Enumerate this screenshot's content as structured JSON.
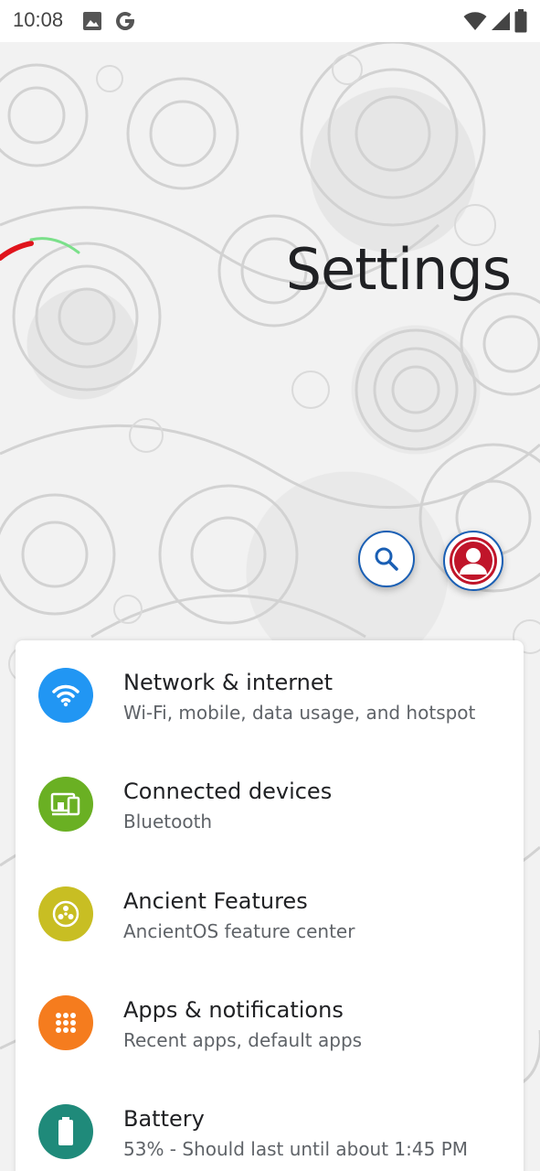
{
  "status_bar": {
    "time": "10:08",
    "left_icons": [
      "image-icon",
      "google-g-icon"
    ],
    "right_icons": [
      "wifi-icon",
      "signal-icon",
      "battery-icon"
    ]
  },
  "header": {
    "title": "Settings",
    "search_icon": "search-icon",
    "account_icon": "account-icon"
  },
  "colors": {
    "network": "#2196F3",
    "connected": "#6AB023",
    "ancient": "#C8BE23",
    "apps": "#F57C1E",
    "battery": "#1F8A7A",
    "account": "#C0152A",
    "accent": "#1A5FB4"
  },
  "items": [
    {
      "title": "Network & internet",
      "summary": "Wi-Fi, mobile, data usage, and hotspot",
      "icon": "wifi-icon"
    },
    {
      "title": "Connected devices",
      "summary": "Bluetooth",
      "icon": "devices-icon"
    },
    {
      "title": "Ancient Features",
      "summary": "AncientOS feature center",
      "icon": "ancient-icon"
    },
    {
      "title": "Apps & notifications",
      "summary": "Recent apps, default apps",
      "icon": "apps-grid-icon"
    },
    {
      "title": "Battery",
      "summary": "53% - Should last until about 1:45 PM",
      "icon": "battery-icon"
    }
  ]
}
